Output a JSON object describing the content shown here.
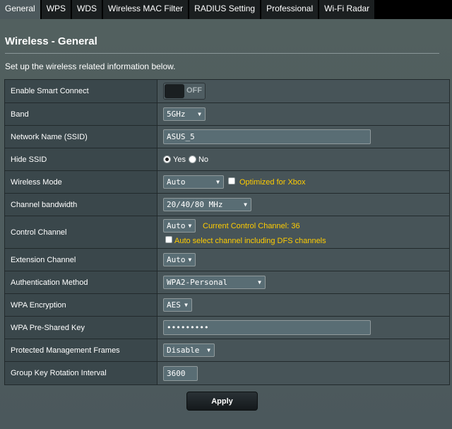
{
  "tabs": [
    "General",
    "WPS",
    "WDS",
    "Wireless MAC Filter",
    "RADIUS Setting",
    "Professional",
    "Wi-Fi Radar"
  ],
  "page": {
    "title": "Wireless - General",
    "subtitle": "Set up the wireless related information below."
  },
  "form": {
    "smart_connect": {
      "label": "Enable Smart Connect",
      "state": "OFF"
    },
    "band": {
      "label": "Band",
      "value": "5GHz"
    },
    "ssid": {
      "label": "Network Name (SSID)",
      "value": "ASUS_5"
    },
    "hide_ssid": {
      "label": "Hide SSID",
      "yes": "Yes",
      "no": "No"
    },
    "wireless_mode": {
      "label": "Wireless Mode",
      "value": "Auto",
      "xbox": "Optimized for Xbox"
    },
    "channel_bandwidth": {
      "label": "Channel bandwidth",
      "value": "20/40/80 MHz"
    },
    "control_channel": {
      "label": "Control Channel",
      "value": "Auto",
      "current": "Current Control Channel: 36",
      "dfs": "Auto select channel including DFS channels"
    },
    "extension_channel": {
      "label": "Extension Channel",
      "value": "Auto"
    },
    "auth_method": {
      "label": "Authentication Method",
      "value": "WPA2-Personal"
    },
    "wpa_encryption": {
      "label": "WPA Encryption",
      "value": "AES"
    },
    "psk": {
      "label": "WPA Pre-Shared Key",
      "value": "•••••••••"
    },
    "pmf": {
      "label": "Protected Management Frames",
      "value": "Disable"
    },
    "gkri": {
      "label": "Group Key Rotation Interval",
      "value": "3600"
    }
  },
  "apply_label": "Apply",
  "colors": {
    "background": "#4d595d",
    "label_cell": "#3a474b",
    "value_cell": "#475458",
    "accent_hint": "#ffcc00",
    "tab_bar": "#000000"
  }
}
